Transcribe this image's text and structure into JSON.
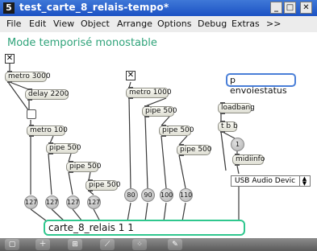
{
  "window": {
    "app_icon": "5",
    "title": "test_carte_8_relais-tempo*",
    "minimize": "_",
    "maximize": "□",
    "close": "✕"
  },
  "menu": [
    "File",
    "Edit",
    "View",
    "Object",
    "Arrange",
    "Options",
    "Debug",
    "Extras",
    ">>"
  ],
  "patch": {
    "comment": "Mode temporisé monostable",
    "toggle_mark": "✕",
    "objects": {
      "metro3000": "metro 3000",
      "delay2200": "delay 2200",
      "metro100": "metro 100",
      "pipe500_a": "pipe 500",
      "pipe500_b": "pipe 500",
      "pipe500_c": "pipe 500",
      "metro1000": "metro 1000",
      "pipe500_d": "pipe 500",
      "pipe500_e": "pipe 500",
      "pipe500_f": "pipe 500",
      "loadbang": "loadbang",
      "tbb": "t b b",
      "midiinfo": "midiinfo"
    },
    "number_boxes": [
      "127",
      "127",
      "127",
      "127",
      "80",
      "90",
      "100",
      "110"
    ],
    "message": "p envoiestatus",
    "small_number": "1",
    "midi_menu": "USB Audio Devic",
    "relay_object": "carte_8_relais 1 1"
  },
  "toolbar_icons": [
    "lock-icon",
    "add-object-icon",
    "grid-icon",
    "graph-icon",
    "grid-dots-icon",
    "tool-icon"
  ]
}
